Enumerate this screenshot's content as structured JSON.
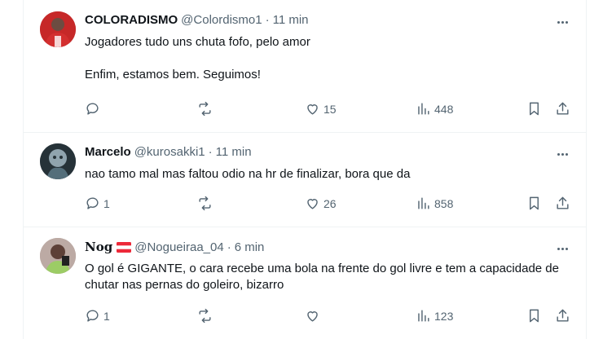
{
  "tweets": [
    {
      "name": "COLORADISMO",
      "handle": "@Colordismo1",
      "dot": "·",
      "time": "11 min",
      "text": "Jogadores tudo uns chuta fofo, pelo amor\n\nEnfim, estamos bem. Seguimos!",
      "replies": "",
      "likes": "15",
      "views": "448"
    },
    {
      "name": "Marcelo",
      "handle": "@kurosakki1",
      "dot": "·",
      "time": "11 min",
      "text": "nao tamo mal mas faltou odio na hr de finalizar, bora que da",
      "replies": "1",
      "likes": "26",
      "views": "858"
    },
    {
      "name": "N⁠o⁠g",
      "handle": "@Nogueiraa_04",
      "dot": "·",
      "time": "6 min",
      "text": "O gol é GIGANTE, o cara recebe uma bola na frente do gol livre e tem a capacidade de chutar nas pernas do goleiro, bizarro",
      "replies": "1",
      "likes": "",
      "views": "123"
    }
  ],
  "icons": {
    "reply": "reply-icon",
    "retweet": "retweet-icon",
    "like": "heart-icon",
    "views": "views-icon",
    "bookmark": "bookmark-icon",
    "share": "share-icon",
    "more": "more-icon"
  },
  "colors": {
    "text": "#0f1419",
    "secondary": "#536471",
    "divider": "#eff3f4"
  }
}
